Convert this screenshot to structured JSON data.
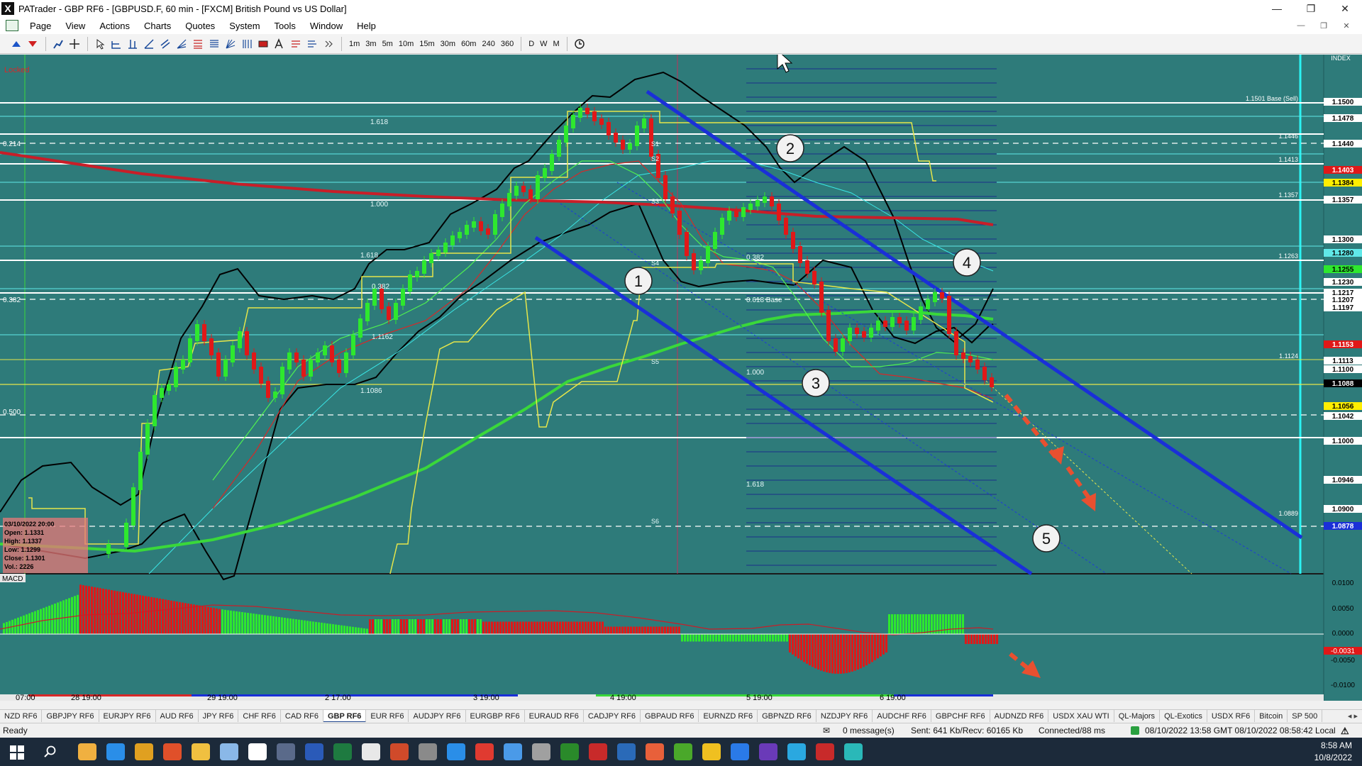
{
  "window": {
    "title": "PATrader - GBP RF6 - [GBPUSD.F, 60 min - [FXCM] British Pound vs US Dollar]"
  },
  "menu": [
    "Page",
    "View",
    "Actions",
    "Charts",
    "Quotes",
    "System",
    "Tools",
    "Window",
    "Help"
  ],
  "timeframes": [
    "1m",
    "3m",
    "5m",
    "10m",
    "15m",
    "30m",
    "60m",
    "240",
    "360",
    "D",
    "W",
    "M"
  ],
  "chart": {
    "locked_label": "Locked",
    "index_label": "INDEX",
    "macd_label": "MACD",
    "left_scale": [
      "0.214",
      "0.382",
      "0.500"
    ],
    "price_axis": [
      "1.1500",
      "1.1478",
      "1.1440",
      "1.1403",
      "1.1384",
      "1.1357",
      "1.1300",
      "1.1280",
      "1.1255",
      "1.1230",
      "1.1217",
      "1.1207",
      "1.1197",
      "1.1153",
      "1.1113",
      "1.1100",
      "1.1088",
      "1.1056",
      "1.1042",
      "1.1000",
      "1.0946",
      "1.0900",
      "1.0878"
    ],
    "macd_axis": [
      "0.0100",
      "0.0050",
      "0.0000",
      "-0.0031",
      "-0.0050",
      "-0.0100"
    ],
    "time_axis": [
      "07:00",
      "28 19:00",
      "29 19:00",
      "2 17:00",
      "3 19:00",
      "4 19:00",
      "5 19:00",
      "6 19:00"
    ],
    "fib_labels": [
      "1.618",
      "1.000",
      "0.382",
      "0.382",
      "1.618",
      "1.1086",
      "1.1162",
      "1.000",
      "1.618",
      "0.618 Base"
    ],
    "pivot_labels": [
      "S1",
      "S2",
      "S3",
      "S4",
      "S5",
      "S6"
    ],
    "right_labels": [
      "1.1501 Base (Sell)",
      "1.1446",
      "1.1413",
      "1.1357",
      "1.1263",
      "1.1124",
      "1.0889"
    ],
    "markers": [
      "1",
      "2",
      "3",
      "4",
      "5"
    ],
    "ohlc": {
      "date": "03/10/2022 20:00",
      "open": "Open: 1.1331",
      "high": "High: 1.1337",
      "low": "Low: 1.1299",
      "close": "Close: 1.1301",
      "vol": "Vol.: 2226"
    }
  },
  "tabs": [
    "NZD RF6",
    "GBPJPY RF6",
    "EURJPY RF6",
    "AUD RF6",
    "JPY RF6",
    "CHF RF6",
    "CAD RF6",
    "GBP RF6",
    "EUR RF6",
    "AUDJPY RF6",
    "EURGBP RF6",
    "EURAUD RF6",
    "CADJPY RF6",
    "GBPAUD RF6",
    "EURNZD RF6",
    "GBPNZD RF6",
    "NZDJPY RF6",
    "AUDCHF RF6",
    "GBPCHF RF6",
    "AUDNZD RF6",
    "USDX XAU WTI",
    "QL-Majors",
    "QL-Exotics",
    "USDX RF6",
    "Bitcoin",
    "SP 500"
  ],
  "active_tab": "GBP RF6",
  "status": {
    "ready": "Ready",
    "messages": "0 message(s)",
    "traffic": "Sent: 641 Kb/Recv: 60165 Kb",
    "connection": "Connected/88 ms",
    "datetime": "08/10/2022 13:58 GMT  08/10/2022 08:58:42 Local"
  },
  "taskbar_clock": {
    "time": "8:58 AM",
    "date": "10/8/2022"
  },
  "colors": {
    "chart_bg": "#2e7b7a",
    "channel": "#1a2fd8",
    "bull": "#2ee82e",
    "bear": "#e01818",
    "ma_red": "#c81e28",
    "ma_green": "#3ad83a"
  }
}
